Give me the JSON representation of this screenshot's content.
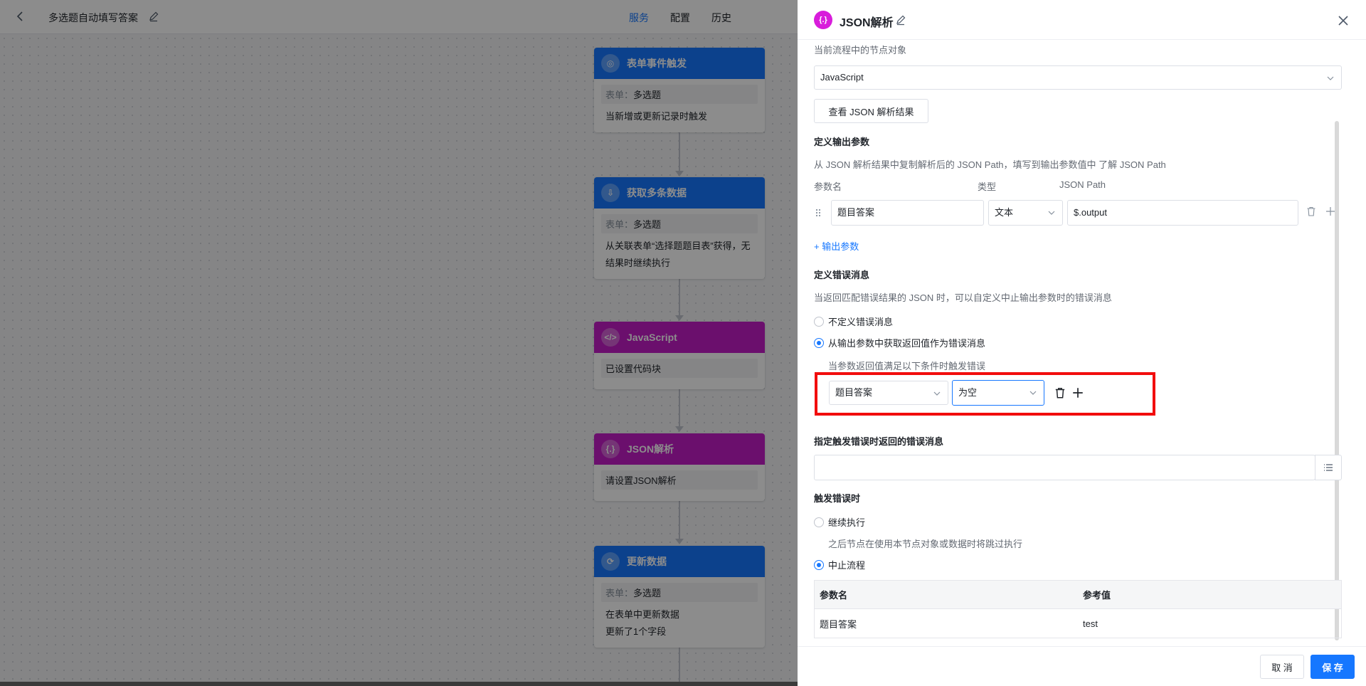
{
  "topbar": {
    "title": "多选题自动填写答案",
    "tabs": [
      "服务",
      "配置",
      "历史"
    ]
  },
  "flow": {
    "nodes": [
      {
        "title": "表单事件触发",
        "icon": "target-icon",
        "color": "#1677ff",
        "form_key": "表单：",
        "form_val": "多选题",
        "lines": [
          "当新增或更新记录时触发"
        ]
      },
      {
        "title": "获取多条数据",
        "icon": "fetch-icon",
        "color": "#1677ff",
        "form_key": "表单：",
        "form_val": "多选题",
        "lines": [
          "从关联表单“选择题题目表”获得，无",
          "结果时继续执行"
        ]
      },
      {
        "title": "JavaScript",
        "icon": "code-icon",
        "color": "#c41dc7",
        "lines_box": [
          "已设置代码块"
        ]
      },
      {
        "title": "JSON解析",
        "icon": "json-icon",
        "color": "#c41dc7",
        "lines_box": [
          "请设置JSON解析"
        ]
      },
      {
        "title": "更新数据",
        "icon": "refresh-icon",
        "color": "#1677ff",
        "form_key": "表单：",
        "form_val": "多选题",
        "lines": [
          "在表单中更新数据",
          "更新了1个字段"
        ]
      }
    ]
  },
  "drawer": {
    "badge": "{.}",
    "title": "JSON解析",
    "node_object_label": "当前流程中的节点对象",
    "node_object_value": "JavaScript",
    "view_result_button": "查看 JSON 解析结果",
    "define_output_title": "定义输出参数",
    "define_output_desc": "从 JSON 解析结果中复制解析后的 JSON Path，填写到输出参数值中 了解 JSON Path",
    "param_headers": {
      "name": "参数名",
      "type": "类型",
      "path": "JSON Path"
    },
    "param_row": {
      "name": "题目答案",
      "type": "文本",
      "path": "$.output"
    },
    "add_output_link": "+ 输出参数",
    "define_error_title": "定义错误消息",
    "define_error_desc": "当返回匹配错误结果的 JSON 时，可以自定义中止输出参数时的错误消息",
    "error_options": [
      "不定义错误消息",
      "从输出参数中获取返回值作为错误消息"
    ],
    "condition_hint": "当参数返回值满足以下条件时触发错误",
    "condition_field": "题目答案",
    "condition_operator": "为空",
    "error_message_title": "指定触发错误时返回的错误消息",
    "error_message_value": "",
    "on_error_title": "触发错误时",
    "on_error_options": [
      "继续执行",
      "中止流程"
    ],
    "continue_hint": "之后节点在使用本节点对象或数据时将跳过执行",
    "table": {
      "headers": [
        "参数名",
        "参考值"
      ],
      "rows": [
        [
          "题目答案",
          "test"
        ]
      ]
    },
    "cancel_button": "取 消",
    "save_button": "保 存"
  },
  "colors": {
    "accent": "#1677ff",
    "purple": "#c41dc7",
    "highlight": "#f20d0d"
  }
}
